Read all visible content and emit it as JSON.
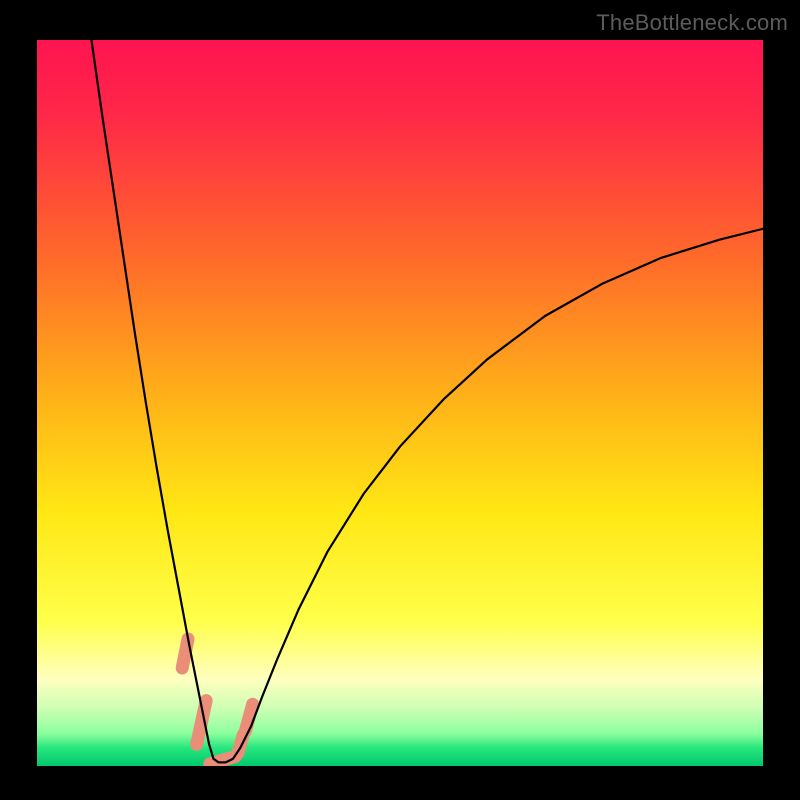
{
  "watermark": "TheBottleneck.com",
  "chart_data": {
    "type": "line",
    "title": "",
    "xlabel": "",
    "ylabel": "",
    "xlim": [
      0,
      100
    ],
    "ylim": [
      0,
      100
    ],
    "grid": false,
    "legend": false,
    "gradient_stops": [
      {
        "offset": 0.0,
        "color": "#ff1450"
      },
      {
        "offset": 0.1,
        "color": "#ff2748"
      },
      {
        "offset": 0.3,
        "color": "#ff6a2a"
      },
      {
        "offset": 0.5,
        "color": "#ffb418"
      },
      {
        "offset": 0.65,
        "color": "#ffe714"
      },
      {
        "offset": 0.8,
        "color": "#ffff4a"
      },
      {
        "offset": 0.88,
        "color": "#ffffbe"
      },
      {
        "offset": 0.92,
        "color": "#ceffb4"
      },
      {
        "offset": 0.955,
        "color": "#8cff9e"
      },
      {
        "offset": 0.975,
        "color": "#28e67e"
      },
      {
        "offset": 1.0,
        "color": "#00c86e"
      }
    ],
    "series": [
      {
        "name": "bottleneck-curve",
        "color": "#000000",
        "x": [
          7.5,
          9.0,
          10.5,
          12.0,
          13.5,
          15.0,
          16.5,
          18.0,
          19.5,
          21.0,
          22.0,
          23.0,
          23.7,
          24.3,
          25.0,
          26.0,
          27.0,
          28.0,
          29.5,
          31.0,
          33.0,
          36.0,
          40.0,
          45.0,
          50.0,
          56.0,
          62.0,
          70.0,
          78.0,
          86.0,
          94.0,
          100.0
        ],
        "y": [
          100.0,
          89.5,
          79.5,
          69.5,
          59.5,
          50.0,
          41.0,
          32.5,
          24.5,
          16.5,
          11.5,
          6.5,
          3.0,
          1.0,
          0.5,
          0.5,
          1.0,
          2.5,
          5.5,
          9.5,
          14.5,
          21.5,
          29.5,
          37.5,
          44.0,
          50.5,
          56.0,
          62.0,
          66.5,
          70.0,
          72.5,
          74.0
        ]
      }
    ],
    "markers": [
      {
        "name": "marker-left-upper",
        "x_range": [
          20.0,
          20.8
        ],
        "y_range": [
          13.5,
          17.5
        ],
        "color": "#ea8d79"
      },
      {
        "name": "marker-left-lower",
        "x_range": [
          22.0,
          23.3
        ],
        "y_range": [
          3.0,
          9.0
        ],
        "color": "#ea8d79"
      },
      {
        "name": "marker-bottom",
        "x_range": [
          23.8,
          27.3
        ],
        "y_range": [
          0.3,
          1.3
        ],
        "color": "#ea8d79"
      },
      {
        "name": "marker-right-lower",
        "x_range": [
          27.7,
          28.4
        ],
        "y_range": [
          1.8,
          4.3
        ],
        "color": "#ea8d79"
      },
      {
        "name": "marker-right-upper",
        "x_range": [
          28.7,
          29.7
        ],
        "y_range": [
          4.8,
          8.5
        ],
        "color": "#ea8d79"
      }
    ]
  }
}
